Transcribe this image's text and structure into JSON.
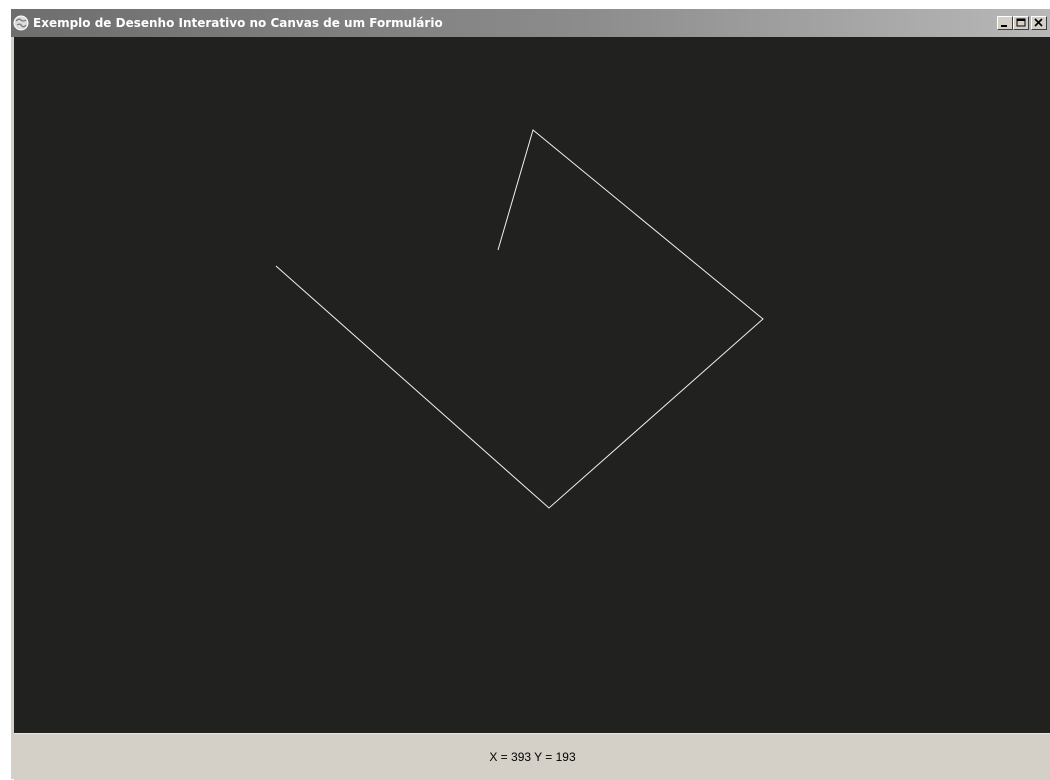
{
  "window": {
    "title": "Exemplo de Desenho Interativo no Canvas de um Formulário",
    "icon": "globe-icon"
  },
  "controls": {
    "minimize_icon": "minimize-icon",
    "maximize_icon": "maximize-icon",
    "close_icon": "close-icon"
  },
  "canvas": {
    "background_color": "#21221f",
    "stroke_color": "#f0f0f0"
  },
  "status": {
    "coordinates": "X = 393 Y = 193"
  }
}
